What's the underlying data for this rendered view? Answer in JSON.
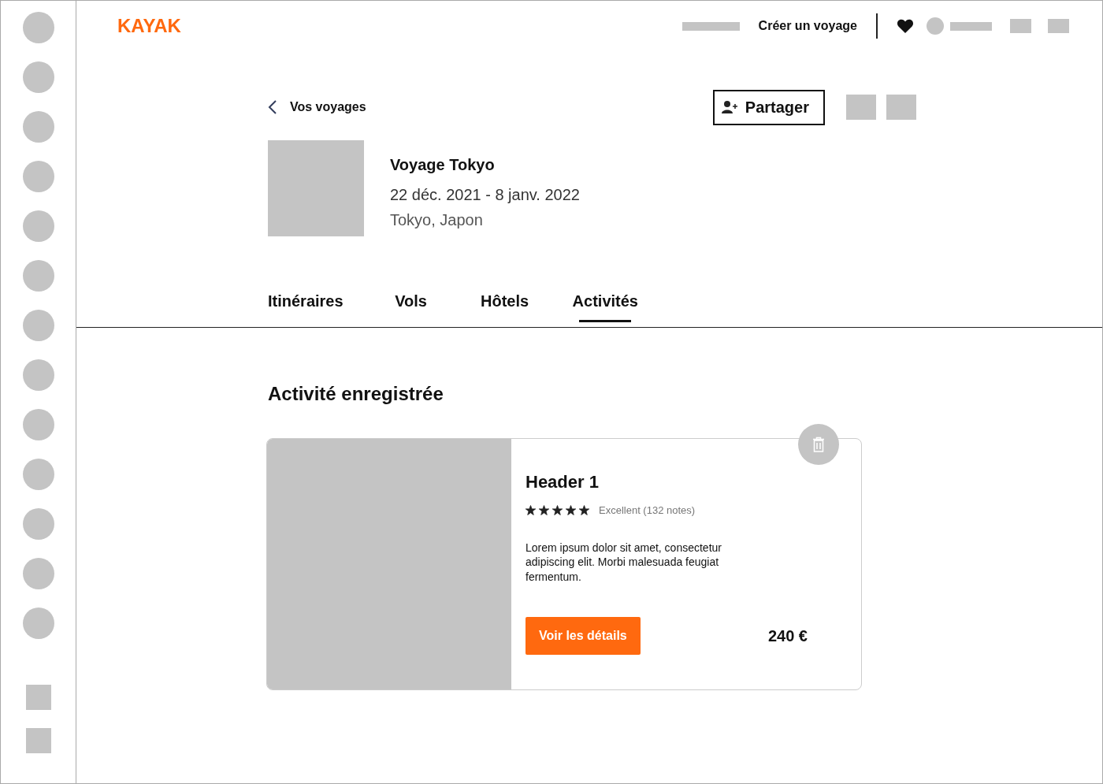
{
  "logo": "KAYAK",
  "sidebar": {
    "items": [
      {
        "kind": "circle"
      },
      {
        "kind": "circle"
      },
      {
        "kind": "circle"
      },
      {
        "kind": "circle"
      },
      {
        "kind": "circle"
      },
      {
        "kind": "circle"
      },
      {
        "kind": "circle"
      },
      {
        "kind": "circle"
      },
      {
        "kind": "circle"
      },
      {
        "kind": "circle"
      },
      {
        "kind": "circle"
      },
      {
        "kind": "circle"
      },
      {
        "kind": "circle"
      },
      {
        "kind": "square"
      },
      {
        "kind": "square"
      }
    ]
  },
  "top_nav": {
    "create_trip": "Créer un voyage"
  },
  "back_link": "Vos voyages",
  "share_button": "Partager",
  "trip": {
    "title": "Voyage Tokyo",
    "dates": "22 déc. 2021 - 8 janv. 2022",
    "location": "Tokyo, Japon"
  },
  "tabs": [
    {
      "label": "Itinéraires",
      "selected": false
    },
    {
      "label": "Vols",
      "selected": false
    },
    {
      "label": "Hôtels",
      "selected": false
    },
    {
      "label": "Activités",
      "selected": true
    }
  ],
  "section_title": "Activité enregistrée",
  "activities": [
    {
      "title": "Header 1",
      "stars": 5,
      "rating": "Excellent (132 notes)",
      "description": "Lorem ipsum dolor sit amet, consectetur adipiscing elit. Morbi malesuada feugiat fermentum.",
      "button": "Voir les détails",
      "price": "240 €"
    }
  ]
}
